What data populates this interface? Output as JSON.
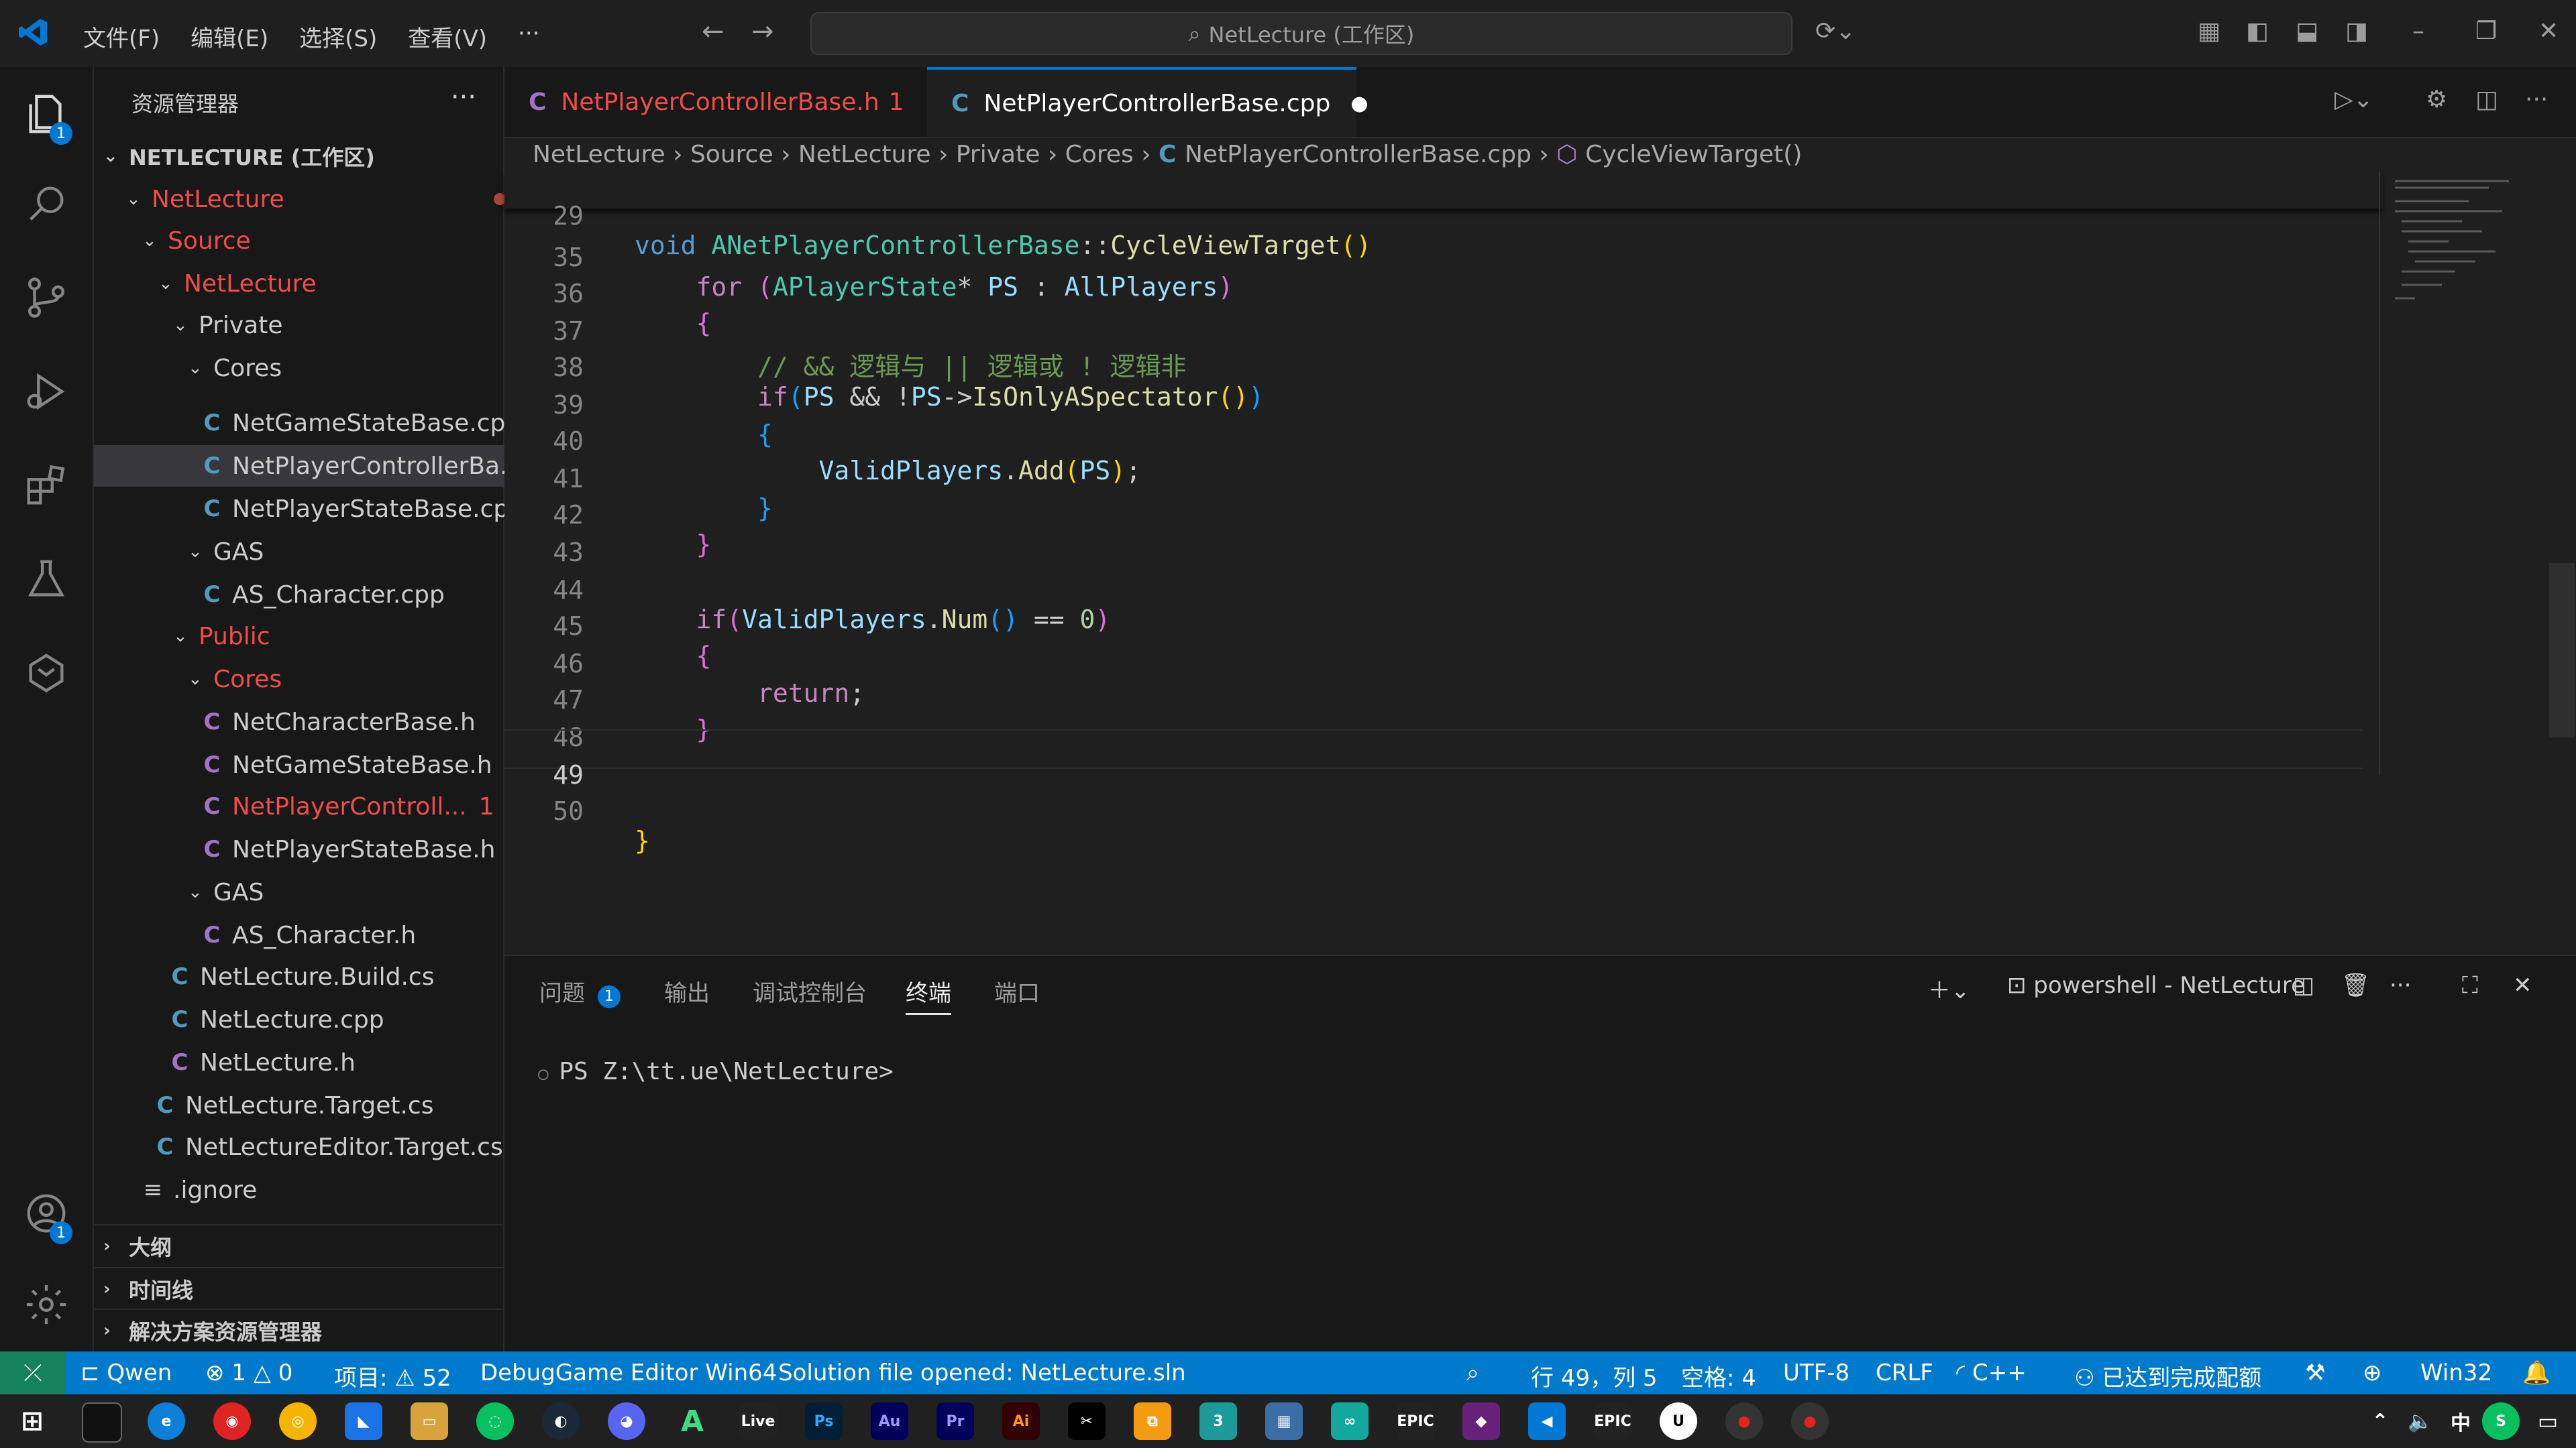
{
  "titlebar": {
    "menus": [
      "文件(F)",
      "编辑(E)",
      "选择(S)",
      "查看(V)"
    ],
    "more": "···",
    "search_text": "NetLecture (工作区)"
  },
  "activity_bar": {
    "explorer_badge": "1",
    "accounts_badge": "1"
  },
  "sidebar": {
    "title": "资源管理器",
    "more": "···",
    "workspace": "NETLECTURE (工作区)",
    "tree": [
      {
        "label": "NetLecture",
        "type": "folder",
        "modified": true
      },
      {
        "label": "Source",
        "type": "folder",
        "modified": true
      },
      {
        "label": "NetLecture",
        "type": "folder",
        "modified": true
      },
      {
        "label": "Private",
        "type": "folder"
      },
      {
        "label": "Cores",
        "type": "folder"
      },
      {
        "label": "NetGameStateBase.cpp",
        "type": "cpp"
      },
      {
        "label": "NetPlayerControllerBa...",
        "type": "cpp",
        "selected": true
      },
      {
        "label": "NetPlayerStateBase.cpp",
        "type": "cpp"
      },
      {
        "label": "GAS",
        "type": "folder"
      },
      {
        "label": "AS_Character.cpp",
        "type": "cpp"
      },
      {
        "label": "Public",
        "type": "folder",
        "modified": true
      },
      {
        "label": "Cores",
        "type": "folder",
        "modified": true
      },
      {
        "label": "NetCharacterBase.h",
        "type": "h"
      },
      {
        "label": "NetGameStateBase.h",
        "type": "h"
      },
      {
        "label": "NetPlayerControll...",
        "type": "h",
        "modified": true,
        "count": "1"
      },
      {
        "label": "NetPlayerStateBase.h",
        "type": "h"
      },
      {
        "label": "GAS",
        "type": "folder"
      },
      {
        "label": "AS_Character.h",
        "type": "h"
      },
      {
        "label": "NetLecture.Build.cs",
        "type": "cs"
      },
      {
        "label": "NetLecture.cpp",
        "type": "cpp"
      },
      {
        "label": "NetLecture.h",
        "type": "h"
      },
      {
        "label": "NetLecture.Target.cs",
        "type": "cs"
      },
      {
        "label": "NetLectureEditor.Target.cs",
        "type": "cs"
      },
      {
        "label": ".ignore",
        "type": "txt"
      }
    ],
    "sections": [
      "大纲",
      "时间线",
      "解决方案资源管理器"
    ]
  },
  "tabs": [
    {
      "label": "NetPlayerControllerBase.h",
      "count": "1"
    },
    {
      "label": "NetPlayerControllerBase.cpp",
      "dirty": "●"
    }
  ],
  "breadcrumb": {
    "items": [
      "NetLecture",
      "Source",
      "NetLecture",
      "Private",
      "Cores",
      "NetPlayerControllerBase.cpp",
      "CycleViewTarget()"
    ]
  },
  "editor": {
    "sticky_line": "29",
    "lines": [
      "35",
      "36",
      "37",
      "38",
      "39",
      "40",
      "41",
      "42",
      "43",
      "44",
      "45",
      "46",
      "47",
      "48",
      "49",
      "50"
    ],
    "comment": "// && 逻辑与 || 逻辑或 ! 逻辑非"
  },
  "panel": {
    "tabs": [
      "问题",
      "输出",
      "调试控制台",
      "终端",
      "端口"
    ],
    "problems_badge": "1",
    "terminal_name": "powershell - NetLecture",
    "prompt": "PS Z:\\tt.ue\\NetLecture>"
  },
  "status": {
    "copilot": "Qwen",
    "errors": "1",
    "warnings": "0",
    "project": "项目: ⚠ 52",
    "config": "DebugGame Editor Win64",
    "solution": "Solution file opened: NetLecture.sln",
    "position": "行 49，列 5",
    "spaces": "空格: 4",
    "encoding": "UTF-8",
    "eol": "CRLF",
    "language": "C++",
    "quota": "已达到完成配额",
    "platform": "Win32"
  },
  "colors": {
    "accent": "#0078d4",
    "status_bar": "#007acc",
    "modified": "#f14c4c"
  }
}
